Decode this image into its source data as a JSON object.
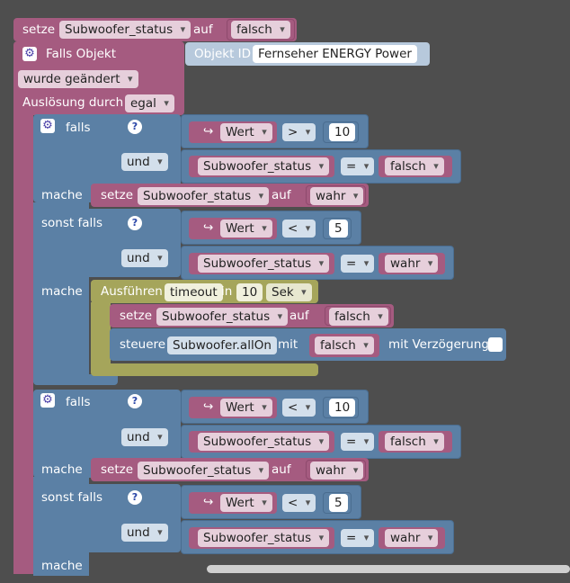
{
  "top": {
    "setze": "setze",
    "var": "Subwoofer_status",
    "auf": "auf",
    "value": "falsch"
  },
  "trigger": {
    "title": "Falls Objekt",
    "objekt_id_label": "Objekt ID",
    "objekt_id_value": "Fernseher ENERGY  Power",
    "wurde": "wurde geändert",
    "ausloesung": "Auslösung durch",
    "egal": "egal"
  },
  "kw": {
    "falls": "falls",
    "und": "und",
    "mache": "mache",
    "sonst_falls": "sonst falls",
    "setze": "setze",
    "auf": "auf",
    "wert": "Wert",
    "steuere": "steuere",
    "mit": "mit",
    "mit_verzoegerung": "mit Verzögerung"
  },
  "if1": {
    "cond1": {
      "op": ">",
      "num": "10"
    },
    "cond2": {
      "var": "Subwoofer_status",
      "op": "=",
      "val": "falsch"
    },
    "do": {
      "var": "Subwoofer_status",
      "val": "wahr"
    },
    "elif_cond1": {
      "op": "<",
      "num": "5"
    },
    "elif_cond2": {
      "var": "Subwoofer_status",
      "op": "=",
      "val": "wahr"
    },
    "timeout": {
      "label": "Ausführen",
      "name": "timeout",
      "in": "in",
      "num": "10",
      "unit": "Sek"
    },
    "inner_set": {
      "var": "Subwoofer_status",
      "val": "falsch"
    },
    "control": {
      "target": "Subwoofer.allOn",
      "val": "falsch"
    }
  },
  "if2": {
    "cond1": {
      "op": "<",
      "num": "10"
    },
    "cond2": {
      "var": "Subwoofer_status",
      "op": "=",
      "val": "falsch"
    },
    "do": {
      "var": "Subwoofer_status",
      "val": "wahr"
    },
    "elif_cond1": {
      "op": "<",
      "num": "5"
    },
    "elif_cond2": {
      "var": "Subwoofer_status",
      "op": "=",
      "val": "wahr"
    }
  },
  "icons": {
    "gear": "gear-icon",
    "help": "help-icon",
    "arrow": "return-arrow-icon"
  }
}
